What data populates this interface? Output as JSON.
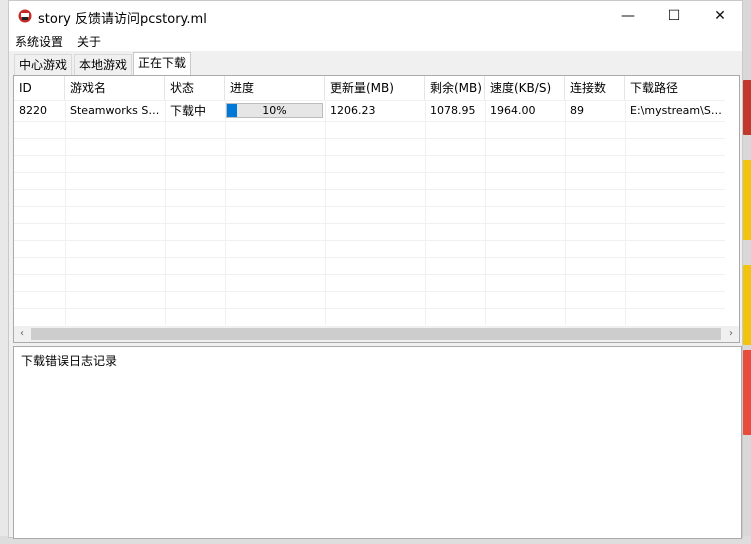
{
  "window": {
    "title": "story 反馈请访问pcstory.ml",
    "controls": {
      "minimize": "—",
      "maximize": "☐",
      "close": "✕"
    }
  },
  "menu": {
    "items": [
      "系统设置",
      "关于"
    ]
  },
  "tabs": [
    "中心游戏",
    "本地游戏",
    "正在下载"
  ],
  "active_tab": "正在下载",
  "table": {
    "columns": [
      "ID",
      "游戏名",
      "状态",
      "进度",
      "更新量(MB)",
      "剩余(MB)",
      "速度(KB/S)",
      "连接数",
      "下载路径"
    ],
    "rows": [
      {
        "id": "8220",
        "name": "Steamworks Sh...",
        "status": "下载中",
        "progress_text": "10%",
        "progress": 0.1,
        "update_mb": "1206.23",
        "remaining_mb": "1078.95",
        "speed": "1964.00",
        "connections": "89",
        "path": "E:\\mystream\\Steam..."
      }
    ],
    "scroll_left": "‹",
    "scroll_right": "›"
  },
  "log": {
    "label": "下载错误日志记录"
  },
  "colors": {
    "progress_fill": "#0078d7",
    "app_icon": "#c62828"
  }
}
